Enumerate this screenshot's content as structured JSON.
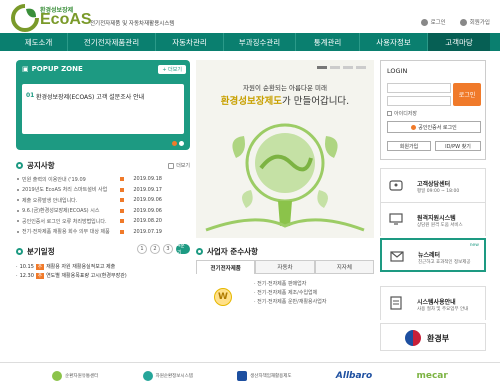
{
  "header": {
    "logo_kr": "환경성보장제",
    "logo_en": "EcoAS",
    "logo_sub": "전기전자제품 및 자동차재활용시스템",
    "login": "로그인",
    "join": "회원가입"
  },
  "nav": [
    "제도소개",
    "전기전자제품관리",
    "자동차관리",
    "부과징수관리",
    "통계관리",
    "사용자정보",
    "고객마당"
  ],
  "popup": {
    "title": "POPUP ZONE",
    "more": "+ 더보기",
    "num": "01",
    "text": "환경성보장제(ECOAS) 고객 설문조사 안내"
  },
  "banner": {
    "line1": "자원이 순환되는 아름다운 미래",
    "line2_hl": "환경성보장제도",
    "line2_rest": "가 만들어갑니다."
  },
  "notice": {
    "title": "공지사항",
    "more": "더보기",
    "items": [
      {
        "text": "민원 출력의 이용안내 ('19.09",
        "date": "2019.09.18",
        "new": true
      },
      {
        "text": "2019년도 EcoAS 처리 스마트설비 사업",
        "date": "2019.09.17",
        "new": true
      },
      {
        "text": "제출 오류발생 안내입니다.",
        "date": "2019.09.06",
        "new": true
      },
      {
        "text": "9.6.(금)환경성보장제(ECOAS) 시스",
        "date": "2019.09.06",
        "new": true
      },
      {
        "text": "공인인증서 로그인 오류 처리방법입니다.",
        "date": "2019.08.20",
        "new": true
      },
      {
        "text": "전기·전자제품 재활용 회수 의무 대상 제품",
        "date": "2019.07.19",
        "new": true
      }
    ]
  },
  "schedule": {
    "title": "분기일정",
    "pages": [
      "1",
      "2",
      "3",
      "4분기"
    ],
    "items": [
      {
        "date": "10.15",
        "tag": "추",
        "text": "재활용 자원 재활용실적보고 제출"
      },
      {
        "date": "12.30",
        "tag": "추",
        "text": "연도별 재활용목표량 고시(환경부장관)"
      }
    ]
  },
  "compliance": {
    "title": "사업자 준수사항",
    "tabs": [
      "전기전자제품",
      "자동차",
      "지자체"
    ],
    "bulb": "W",
    "items": [
      "· 전기·전자제품 판매업자",
      "· 전기·전자제품 제조/수입업체",
      "· 전기·전자제품 운반/재활용사업자"
    ]
  },
  "login": {
    "title": "LOGIN",
    "btn": "로그인",
    "save_id": "아이디저장",
    "cert": "공인인증서 로그인",
    "join": "회원가입",
    "find": "ID/PW 찾기"
  },
  "quick": [
    {
      "title": "고객상담센터",
      "sub": "평일 09:00 ~ 18:00",
      "new": ""
    },
    {
      "title": "원격지원시스템",
      "sub": "상담원 원격 도움 서비스",
      "new": ""
    },
    {
      "title": "뉴스레터",
      "sub": "친근하고 효과적인 정보제공",
      "new": "new"
    },
    {
      "title": "시스템사용안내",
      "sub": "사용 절차 및 주요업무 안내",
      "new": ""
    }
  ],
  "moe": "환경부",
  "footer": [
    "순환자원유통센터",
    "자원순환정보시스템",
    "생산자책임재활용제도",
    "Allbaro",
    "mecar"
  ],
  "colors": {
    "primary": "#0a7f6f",
    "accent": "#f07a2a"
  }
}
